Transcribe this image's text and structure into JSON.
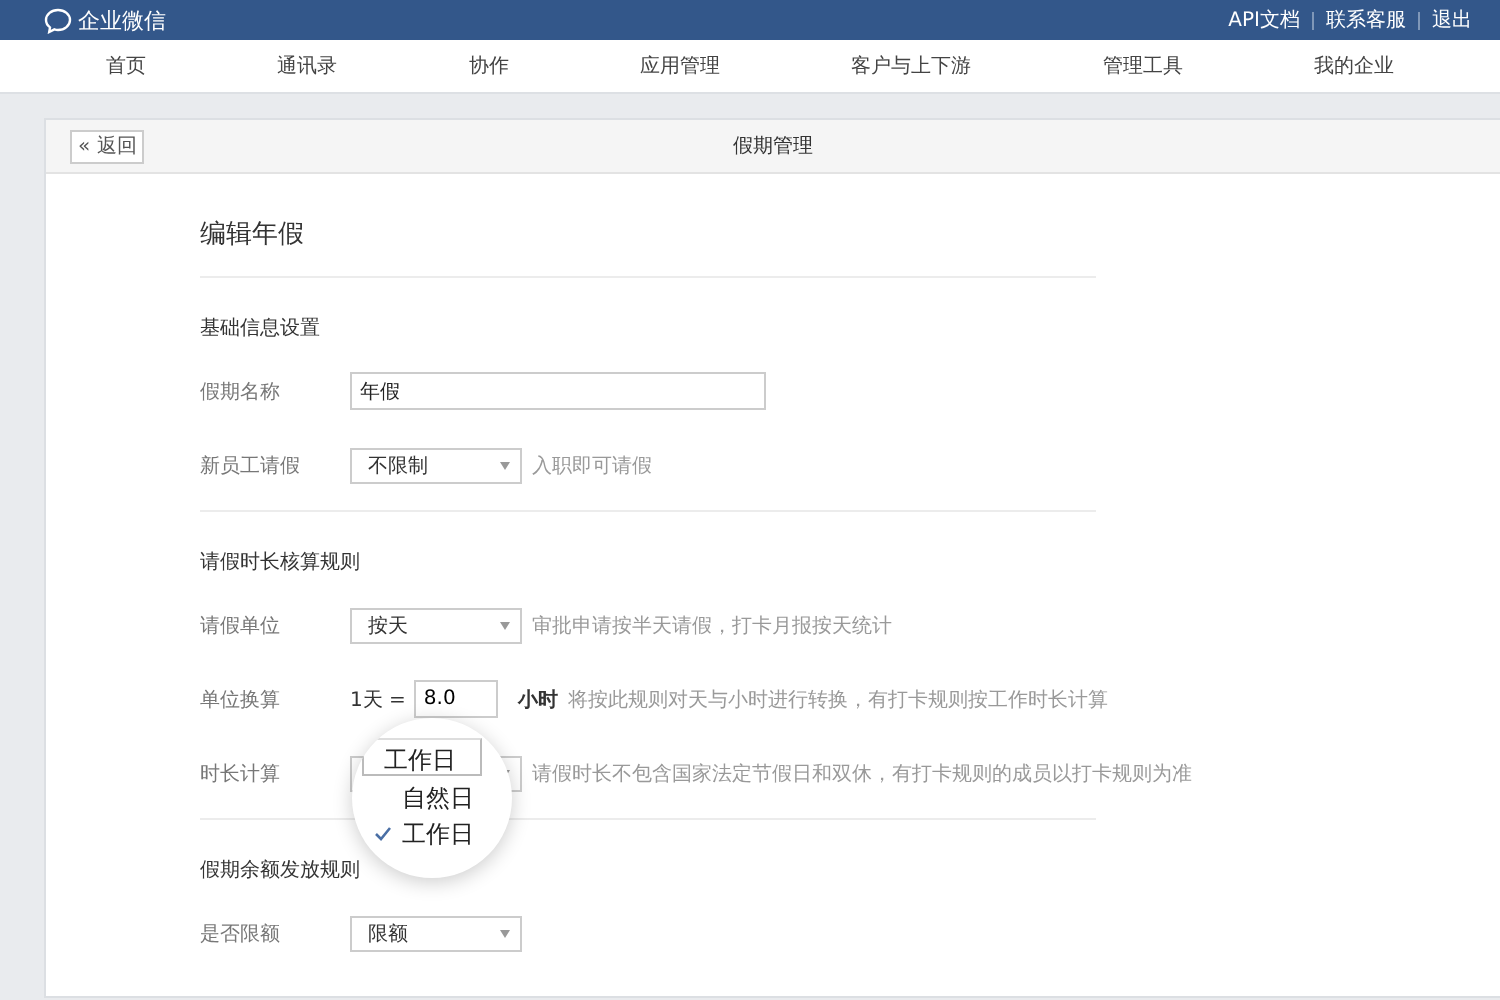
{
  "topbar": {
    "logo_text": "企业微信",
    "links": [
      "API文档",
      "联系客服",
      "退出"
    ]
  },
  "nav": {
    "items": [
      "首页",
      "通讯录",
      "协作",
      "应用管理",
      "客户与上下游",
      "管理工具",
      "我的企业"
    ]
  },
  "panel": {
    "back_button": "« 返回",
    "title": "假期管理"
  },
  "form": {
    "heading": "编辑年假",
    "sections": [
      {
        "title": "基础信息设置",
        "rows": [
          {
            "kind": "input",
            "label": "假期名称",
            "value": "年假"
          },
          {
            "kind": "select",
            "label": "新员工请假",
            "value": "不限制",
            "hint": "入职即可请假"
          }
        ]
      },
      {
        "title": "请假时长核算规则",
        "rows": [
          {
            "kind": "select",
            "label": "请假单位",
            "value": "按天",
            "hint": "审批申请按半天请假，打卡月报按天统计"
          },
          {
            "kind": "conversion",
            "label": "单位换算",
            "prefix": "1天 =",
            "value": "8.0",
            "unit": "小时",
            "hint": "将按此规则对天与小时进行转换，有打卡规则按工作时长计算"
          },
          {
            "kind": "select",
            "label": "时长计算",
            "value": "工作日",
            "hint": "请假时长不包含国家法定节假日和双休，有打卡规则的成员以打卡规则为准",
            "options": [
              {
                "label": "自然日",
                "selected": false
              },
              {
                "label": "工作日",
                "selected": true
              }
            ]
          }
        ]
      },
      {
        "title": "假期余额发放规则",
        "rows": [
          {
            "kind": "select",
            "label": "是否限额",
            "value": "限额"
          }
        ]
      }
    ]
  }
}
